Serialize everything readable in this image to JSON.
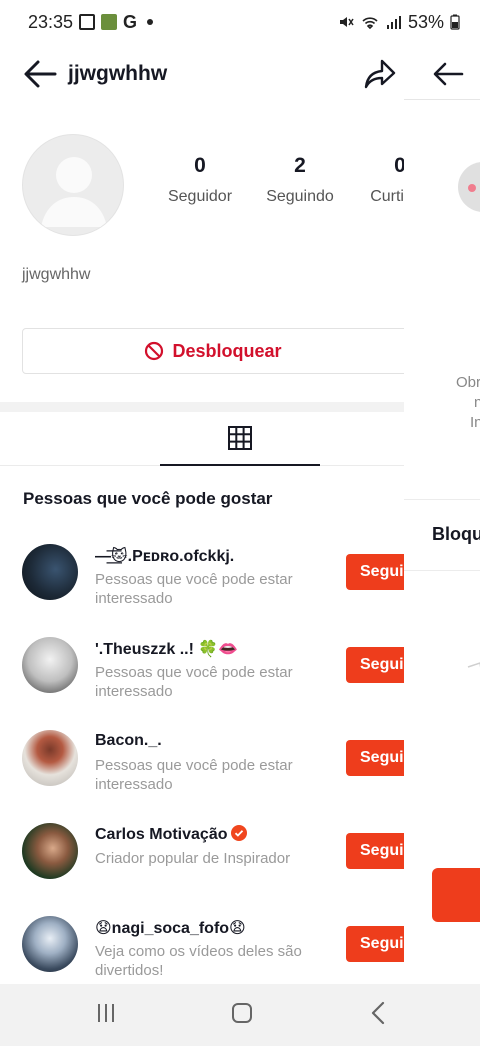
{
  "status_bar": {
    "time": "23:35",
    "g_label": "G",
    "battery": "53%"
  },
  "header": {
    "title": "jjwgwhhw"
  },
  "profile": {
    "stats": [
      {
        "value": "0",
        "label": "Seguidor"
      },
      {
        "value": "2",
        "label": "Seguindo"
      },
      {
        "value": "0",
        "label": "Curtidas"
      }
    ],
    "username": "jjwgwhhw"
  },
  "unblock_button": {
    "label": "Desbloquear"
  },
  "suggestions": {
    "title": "Pessoas que você pode gostar",
    "follow_label": "Seguir",
    "items": [
      {
        "name": "—͟͞🐱.Pᴇᴅʀᴏ.ofckkj.",
        "desc": "Pessoas que você pode estar interessado",
        "avatar_color": "#1d2a38"
      },
      {
        "name": "'.Theuszzk ..! 🍀👄",
        "desc": "Pessoas que você pode estar interessado",
        "avatar_color": "#d9d9d9"
      },
      {
        "name": "Bacon._.",
        "desc": "Pessoas que você pode estar interessado",
        "avatar_color": "#cbc6c2"
      },
      {
        "name": "Carlos Motivação",
        "desc": "Criador popular de Inspirador",
        "avatar_color": "#2e3a2a",
        "verified": true
      },
      {
        "name": "😧nagi_soca_fofo😧",
        "desc": "Veja como os vídeos deles são divertidos!",
        "avatar_color": "#3a4a5e"
      }
    ]
  },
  "right_panel": {
    "texts": [
      "Obr",
      "n",
      "In"
    ],
    "block_label": "Bloqu"
  },
  "colors": {
    "accent": "#ee3d1c",
    "unblock_red": "#d2102c"
  }
}
